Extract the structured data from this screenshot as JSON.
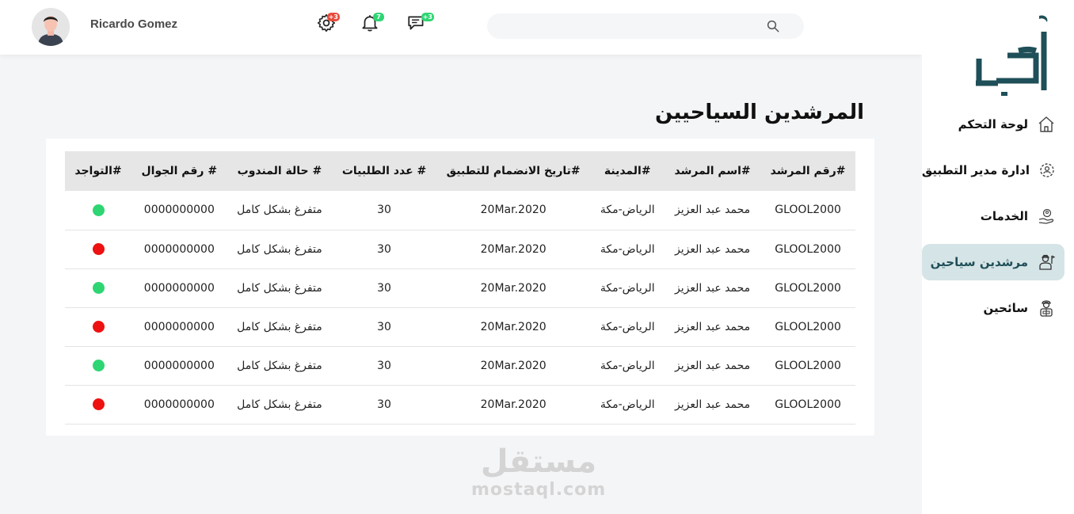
{
  "app": {
    "logo_text": "أرحـب",
    "brand_color": "#1f4f58"
  },
  "sidebar": {
    "items": [
      {
        "label": "لوحة التحكم",
        "icon": "home-icon",
        "active": false
      },
      {
        "label": "ادارة مدير التطبيق",
        "icon": "gear-users-icon",
        "active": false
      },
      {
        "label": "الخدمات",
        "icon": "hand-person-icon",
        "active": false
      },
      {
        "label": "مرشدين سياحين",
        "icon": "guide-icon",
        "active": true
      },
      {
        "label": "سائحين",
        "icon": "tourist-icon",
        "active": false
      }
    ]
  },
  "header": {
    "user_name": "Ricardo Gomez",
    "settings_badge": "+3",
    "notifications_badge": "7",
    "messages_badge": "+3",
    "search_placeholder": "",
    "search_value": ""
  },
  "main": {
    "title": "المرشدين السياحيين",
    "table": {
      "columns": [
        "#رقم المرشد",
        "#اسم المرشد",
        "#المدينة",
        "#تاريخ الانضمام للتطبيق",
        "# عدد الطلبيات",
        "# حالة المندوب",
        "# رقم الجوال",
        "#التواجد"
      ],
      "rows": [
        {
          "id": "GLOOL2000",
          "name": "محمد عبد العزيز",
          "city": "الرياض-مكة",
          "joined": "20Mar.2020",
          "orders": "30",
          "status": "متفرغ بشكل كامل",
          "phone": "0000000000",
          "online": true
        },
        {
          "id": "GLOOL2000",
          "name": "محمد عبد العزيز",
          "city": "الرياض-مكة",
          "joined": "20Mar.2020",
          "orders": "30",
          "status": "متفرغ بشكل كامل",
          "phone": "0000000000",
          "online": false
        },
        {
          "id": "GLOOL2000",
          "name": "محمد عبد العزيز",
          "city": "الرياض-مكة",
          "joined": "20Mar.2020",
          "orders": "30",
          "status": "متفرغ بشكل كامل",
          "phone": "0000000000",
          "online": true
        },
        {
          "id": "GLOOL2000",
          "name": "محمد عبد العزيز",
          "city": "الرياض-مكة",
          "joined": "20Mar.2020",
          "orders": "30",
          "status": "متفرغ بشكل كامل",
          "phone": "0000000000",
          "online": false
        },
        {
          "id": "GLOOL2000",
          "name": "محمد عبد العزيز",
          "city": "الرياض-مكة",
          "joined": "20Mar.2020",
          "orders": "30",
          "status": "متفرغ بشكل كامل",
          "phone": "0000000000",
          "online": true
        },
        {
          "id": "GLOOL2000",
          "name": "محمد عبد العزيز",
          "city": "الرياض-مكة",
          "joined": "20Mar.2020",
          "orders": "30",
          "status": "متفرغ بشكل كامل",
          "phone": "0000000000",
          "online": false
        }
      ]
    },
    "status_colors": {
      "online": "#2ed573",
      "offline": "#ee1111"
    }
  },
  "watermark": {
    "arabic": "مستقل",
    "latin": "mostaql.com"
  }
}
